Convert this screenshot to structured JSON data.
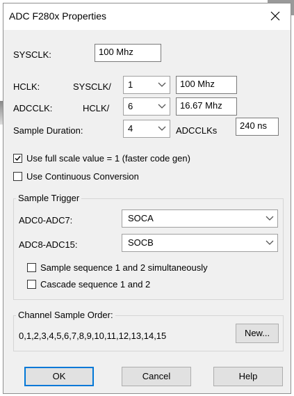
{
  "window": {
    "title": "ADC F280x Properties",
    "close_glyph": "✕"
  },
  "sysclk": {
    "label": "SYSCLK:",
    "value": "100 Mhz"
  },
  "hclk": {
    "label": "HCLK:",
    "divider_label": "SYSCLK/",
    "divider_value": "1",
    "result": "100 Mhz"
  },
  "adcclk": {
    "label": "ADCCLK:",
    "divider_label": "HCLK/",
    "divider_value": "6",
    "result": "16.67 Mhz"
  },
  "sample_duration": {
    "label": "Sample Duration:",
    "value": "4",
    "unit": "ADCCLKs",
    "result": "240 ns"
  },
  "options": {
    "full_scale": {
      "label": "Use full scale value = 1 (faster code gen)",
      "checked": true
    },
    "continuous": {
      "label": "Use Continuous Conversion",
      "checked": false
    }
  },
  "sample_trigger": {
    "legend": "Sample Trigger",
    "adc0_7": {
      "label": "ADC0-ADC7:",
      "value": "SOCA"
    },
    "adc8_15": {
      "label": "ADC8-ADC15:",
      "value": "SOCB"
    },
    "simultaneous": {
      "label": "Sample sequence 1 and 2 simultaneously",
      "checked": false
    },
    "cascade": {
      "label": "Cascade sequence 1 and 2",
      "checked": false
    }
  },
  "channel_order": {
    "legend": "Channel Sample Order:",
    "value": "0,1,2,3,4,5,6,7,8,9,10,11,12,13,14,15",
    "new_button": "New..."
  },
  "buttons": {
    "ok": "OK",
    "cancel": "Cancel",
    "help": "Help"
  },
  "icons": [
    "close-icon",
    "chevron-down-icon",
    "checkmark-icon"
  ]
}
